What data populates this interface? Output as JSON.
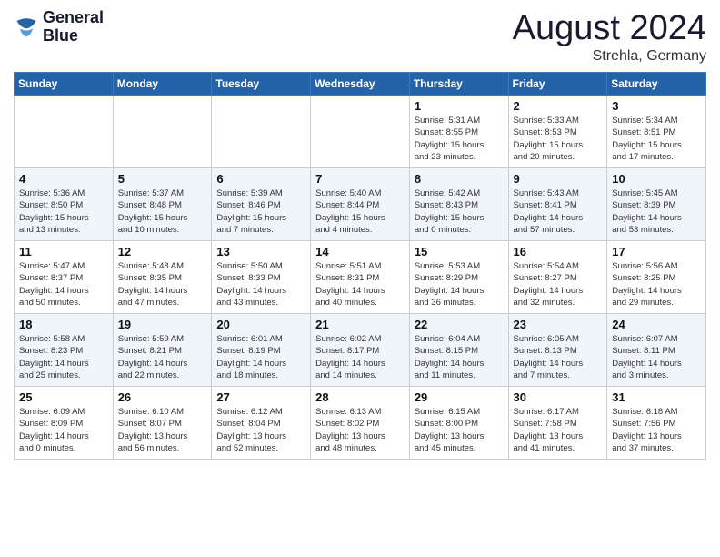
{
  "logo": {
    "line1": "General",
    "line2": "Blue"
  },
  "title": "August 2024",
  "subtitle": "Strehla, Germany",
  "days_of_week": [
    "Sunday",
    "Monday",
    "Tuesday",
    "Wednesday",
    "Thursday",
    "Friday",
    "Saturday"
  ],
  "weeks": [
    [
      {
        "day": "",
        "info": ""
      },
      {
        "day": "",
        "info": ""
      },
      {
        "day": "",
        "info": ""
      },
      {
        "day": "",
        "info": ""
      },
      {
        "day": "1",
        "info": "Sunrise: 5:31 AM\nSunset: 8:55 PM\nDaylight: 15 hours\nand 23 minutes."
      },
      {
        "day": "2",
        "info": "Sunrise: 5:33 AM\nSunset: 8:53 PM\nDaylight: 15 hours\nand 20 minutes."
      },
      {
        "day": "3",
        "info": "Sunrise: 5:34 AM\nSunset: 8:51 PM\nDaylight: 15 hours\nand 17 minutes."
      }
    ],
    [
      {
        "day": "4",
        "info": "Sunrise: 5:36 AM\nSunset: 8:50 PM\nDaylight: 15 hours\nand 13 minutes."
      },
      {
        "day": "5",
        "info": "Sunrise: 5:37 AM\nSunset: 8:48 PM\nDaylight: 15 hours\nand 10 minutes."
      },
      {
        "day": "6",
        "info": "Sunrise: 5:39 AM\nSunset: 8:46 PM\nDaylight: 15 hours\nand 7 minutes."
      },
      {
        "day": "7",
        "info": "Sunrise: 5:40 AM\nSunset: 8:44 PM\nDaylight: 15 hours\nand 4 minutes."
      },
      {
        "day": "8",
        "info": "Sunrise: 5:42 AM\nSunset: 8:43 PM\nDaylight: 15 hours\nand 0 minutes."
      },
      {
        "day": "9",
        "info": "Sunrise: 5:43 AM\nSunset: 8:41 PM\nDaylight: 14 hours\nand 57 minutes."
      },
      {
        "day": "10",
        "info": "Sunrise: 5:45 AM\nSunset: 8:39 PM\nDaylight: 14 hours\nand 53 minutes."
      }
    ],
    [
      {
        "day": "11",
        "info": "Sunrise: 5:47 AM\nSunset: 8:37 PM\nDaylight: 14 hours\nand 50 minutes."
      },
      {
        "day": "12",
        "info": "Sunrise: 5:48 AM\nSunset: 8:35 PM\nDaylight: 14 hours\nand 47 minutes."
      },
      {
        "day": "13",
        "info": "Sunrise: 5:50 AM\nSunset: 8:33 PM\nDaylight: 14 hours\nand 43 minutes."
      },
      {
        "day": "14",
        "info": "Sunrise: 5:51 AM\nSunset: 8:31 PM\nDaylight: 14 hours\nand 40 minutes."
      },
      {
        "day": "15",
        "info": "Sunrise: 5:53 AM\nSunset: 8:29 PM\nDaylight: 14 hours\nand 36 minutes."
      },
      {
        "day": "16",
        "info": "Sunrise: 5:54 AM\nSunset: 8:27 PM\nDaylight: 14 hours\nand 32 minutes."
      },
      {
        "day": "17",
        "info": "Sunrise: 5:56 AM\nSunset: 8:25 PM\nDaylight: 14 hours\nand 29 minutes."
      }
    ],
    [
      {
        "day": "18",
        "info": "Sunrise: 5:58 AM\nSunset: 8:23 PM\nDaylight: 14 hours\nand 25 minutes."
      },
      {
        "day": "19",
        "info": "Sunrise: 5:59 AM\nSunset: 8:21 PM\nDaylight: 14 hours\nand 22 minutes."
      },
      {
        "day": "20",
        "info": "Sunrise: 6:01 AM\nSunset: 8:19 PM\nDaylight: 14 hours\nand 18 minutes."
      },
      {
        "day": "21",
        "info": "Sunrise: 6:02 AM\nSunset: 8:17 PM\nDaylight: 14 hours\nand 14 minutes."
      },
      {
        "day": "22",
        "info": "Sunrise: 6:04 AM\nSunset: 8:15 PM\nDaylight: 14 hours\nand 11 minutes."
      },
      {
        "day": "23",
        "info": "Sunrise: 6:05 AM\nSunset: 8:13 PM\nDaylight: 14 hours\nand 7 minutes."
      },
      {
        "day": "24",
        "info": "Sunrise: 6:07 AM\nSunset: 8:11 PM\nDaylight: 14 hours\nand 3 minutes."
      }
    ],
    [
      {
        "day": "25",
        "info": "Sunrise: 6:09 AM\nSunset: 8:09 PM\nDaylight: 14 hours\nand 0 minutes."
      },
      {
        "day": "26",
        "info": "Sunrise: 6:10 AM\nSunset: 8:07 PM\nDaylight: 13 hours\nand 56 minutes."
      },
      {
        "day": "27",
        "info": "Sunrise: 6:12 AM\nSunset: 8:04 PM\nDaylight: 13 hours\nand 52 minutes."
      },
      {
        "day": "28",
        "info": "Sunrise: 6:13 AM\nSunset: 8:02 PM\nDaylight: 13 hours\nand 48 minutes."
      },
      {
        "day": "29",
        "info": "Sunrise: 6:15 AM\nSunset: 8:00 PM\nDaylight: 13 hours\nand 45 minutes."
      },
      {
        "day": "30",
        "info": "Sunrise: 6:17 AM\nSunset: 7:58 PM\nDaylight: 13 hours\nand 41 minutes."
      },
      {
        "day": "31",
        "info": "Sunrise: 6:18 AM\nSunset: 7:56 PM\nDaylight: 13 hours\nand 37 minutes."
      }
    ]
  ]
}
